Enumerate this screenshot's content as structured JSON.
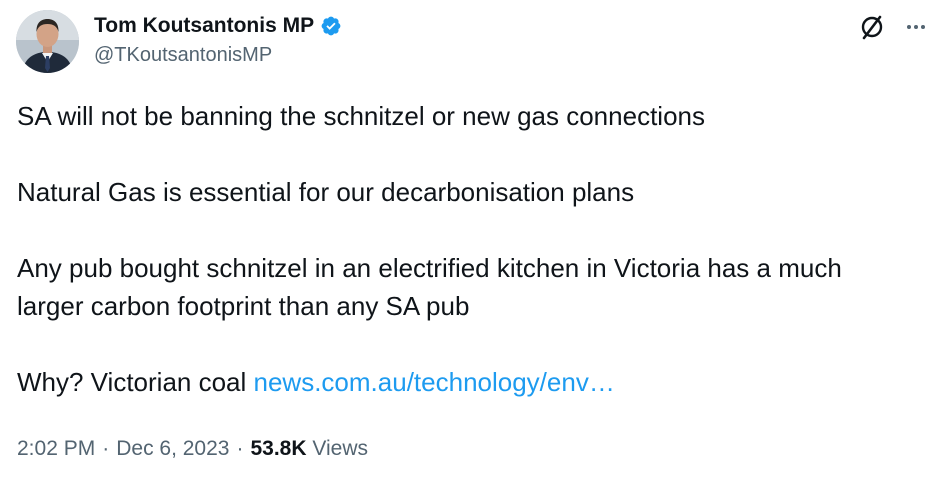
{
  "author": {
    "name": "Tom Koutsantonis MP",
    "handle": "@TKoutsantonisMP",
    "verified": true
  },
  "tweet": {
    "line1": "SA will not be banning the schnitzel or new gas connections",
    "line2": "Natural Gas is essential for our decarbonisation plans",
    "line3a": "Any pub bought schnitzel in an electrified kitchen in Victoria has a much",
    "line3b": "larger carbon footprint than any SA pub",
    "line4_text": "Why? Victorian coal ",
    "line4_link": "news.com.au/technology/env…"
  },
  "meta": {
    "time": "2:02 PM",
    "separator": "·",
    "date": "Dec 6, 2023",
    "views_count": "53.8K",
    "views_label": "Views"
  },
  "icons": {
    "grok": "grok-icon",
    "more": "more-icon",
    "verified": "verified-badge-icon"
  },
  "colors": {
    "text": "#0f1419",
    "secondary": "#536471",
    "link": "#1d9bf0",
    "verified": "#1d9bf0"
  }
}
